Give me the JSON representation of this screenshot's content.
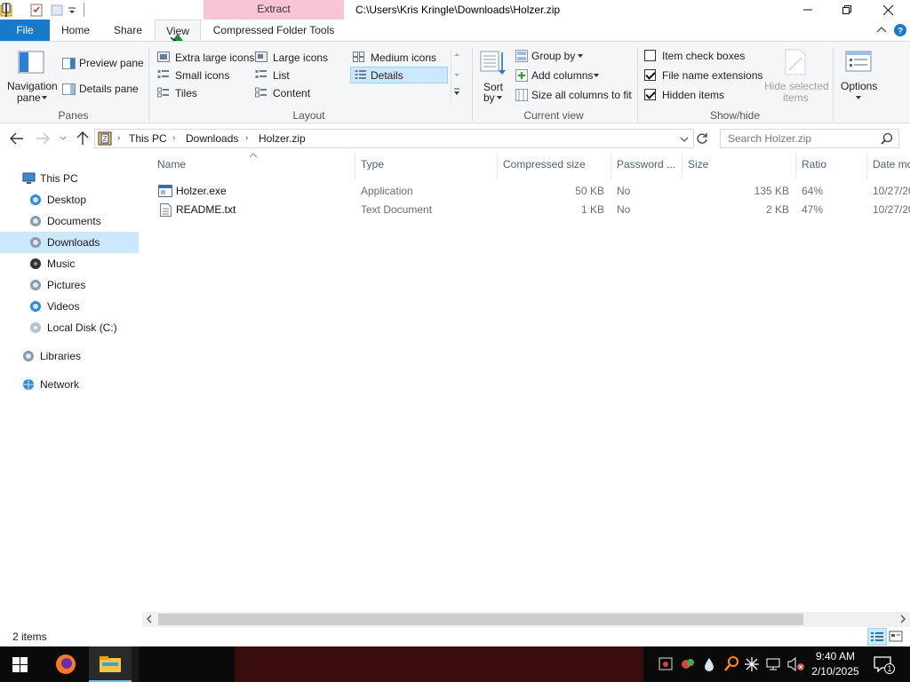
{
  "window": {
    "title": "C:\\Users\\Kris Kringle\\Downloads\\Holzer.zip",
    "context_tab_group": "Extract"
  },
  "ribbon_tabs": {
    "file": "File",
    "home": "Home",
    "share": "Share",
    "view": "View",
    "compressed": "Compressed Folder Tools"
  },
  "ribbon": {
    "panes": {
      "group": "Panes",
      "navigation_pane": "Navigation",
      "navigation_pane2": "pane",
      "preview_pane": "Preview pane",
      "details_pane": "Details pane"
    },
    "layout": {
      "group": "Layout",
      "extra_large_icons": "Extra large icons",
      "large_icons": "Large icons",
      "medium_icons": "Medium icons",
      "small_icons": "Small icons",
      "list": "List",
      "details": "Details",
      "tiles": "Tiles",
      "content": "Content"
    },
    "current_view": {
      "group": "Current view",
      "sort_by": "Sort",
      "sort_by2": "by",
      "group_by": "Group by",
      "add_columns": "Add columns",
      "size_all_columns": "Size all columns to fit"
    },
    "show_hide": {
      "group": "Show/hide",
      "item_check_boxes": "Item check boxes",
      "file_name_extensions": "File name extensions",
      "hidden_items": "Hidden items",
      "hide_selected": "Hide selected",
      "hide_selected2": "items",
      "item_check_boxes_checked": false,
      "file_name_extensions_checked": true,
      "hidden_items_checked": true
    },
    "options": "Options"
  },
  "address": {
    "crumbs": [
      "This PC",
      "Downloads",
      "Holzer.zip"
    ],
    "search_placeholder": "Search Holzer.zip"
  },
  "nav": {
    "items": [
      {
        "label": "This PC",
        "icon": "computer-icon"
      },
      {
        "label": "Desktop",
        "icon": "desktop-folder-icon"
      },
      {
        "label": "Documents",
        "icon": "documents-folder-icon"
      },
      {
        "label": "Downloads",
        "icon": "downloads-folder-icon"
      },
      {
        "label": "Music",
        "icon": "music-folder-icon"
      },
      {
        "label": "Pictures",
        "icon": "pictures-folder-icon"
      },
      {
        "label": "Videos",
        "icon": "videos-folder-icon"
      },
      {
        "label": "Local Disk (C:)",
        "icon": "disk-icon"
      },
      {
        "label": "Libraries",
        "icon": "libraries-icon"
      },
      {
        "label": "Network",
        "icon": "network-icon"
      }
    ],
    "selected": "Downloads"
  },
  "columns": [
    "Name",
    "Type",
    "Compressed size",
    "Password ...",
    "Size",
    "Ratio",
    "Date mo"
  ],
  "files": [
    {
      "name": "Holzer.exe",
      "type": "Application",
      "compressed": "50 KB",
      "password": "No",
      "size": "135 KB",
      "ratio": "64%",
      "date": "10/27/20"
    },
    {
      "name": "README.txt",
      "type": "Text Document",
      "compressed": "1 KB",
      "password": "No",
      "size": "2 KB",
      "ratio": "47%",
      "date": "10/27/20"
    }
  ],
  "status": {
    "item_count": "2 items"
  },
  "taskbar": {
    "time": "9:40 AM",
    "date": "2/10/2025",
    "notification_count": "1"
  },
  "colors": {
    "accent": "#1979ca",
    "selection": "#cce8ff",
    "context_tab": "#f7c5d6"
  }
}
